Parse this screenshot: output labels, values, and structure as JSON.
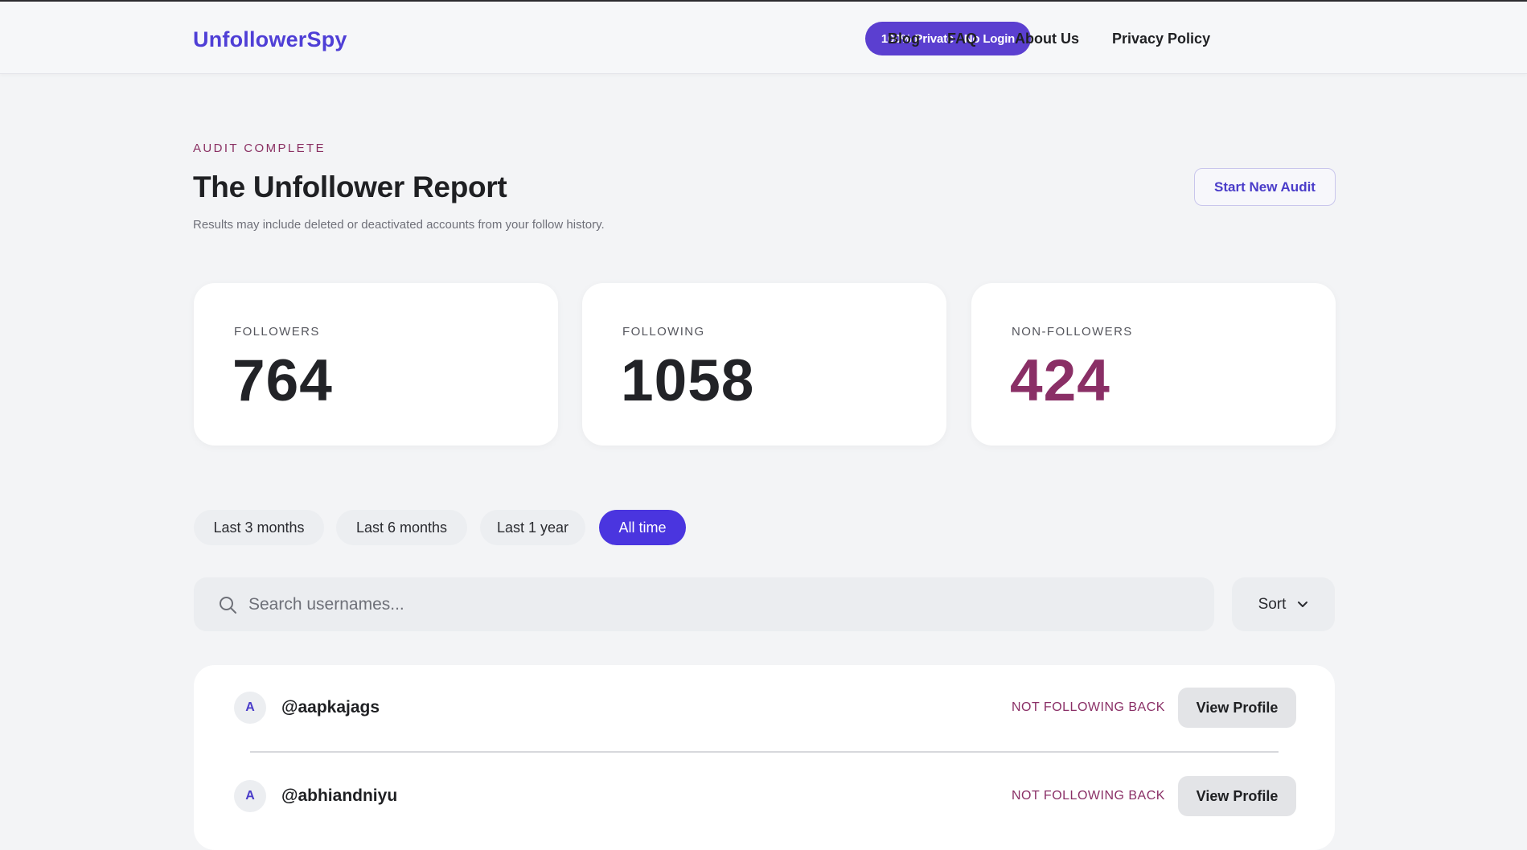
{
  "brand": "UnfollowerSpy",
  "nav": {
    "privacy_badge": "100% Private · No Login",
    "links": [
      "Blog",
      "FAQ",
      "About Us",
      "Privacy Policy"
    ]
  },
  "header": {
    "eyebrow": "AUDIT COMPLETE",
    "title": "The Unfollower Report",
    "subtitle": "Results may include deleted or deactivated accounts from your follow history.",
    "start_audit": "Start New Audit"
  },
  "stats": [
    {
      "label": "FOLLOWERS",
      "value": "764"
    },
    {
      "label": "FOLLOWING",
      "value": "1058"
    },
    {
      "label": "NON-FOLLOWERS",
      "value": "424"
    }
  ],
  "filters": {
    "options": [
      "Last 3 months",
      "Last 6 months",
      "Last 1 year",
      "All time"
    ],
    "selected": "All time"
  },
  "search": {
    "placeholder": "Search usernames...",
    "value": ""
  },
  "sort": {
    "label": "Sort"
  },
  "results": [
    {
      "initial": "A",
      "username": "@aapkajags",
      "status": "NOT FOLLOWING BACK",
      "action": "View Profile"
    },
    {
      "initial": "A",
      "username": "@abhiandniyu",
      "status": "NOT FOLLOWING BACK",
      "action": "View Profile"
    }
  ],
  "colors": {
    "brand": "#4f3fd6",
    "accent": "#8a2f66",
    "active_filter": "#4a35df",
    "background": "#f3f4f6"
  },
  "icons": {
    "search": "search-icon",
    "sort_chevron": "chevron-down-icon"
  }
}
